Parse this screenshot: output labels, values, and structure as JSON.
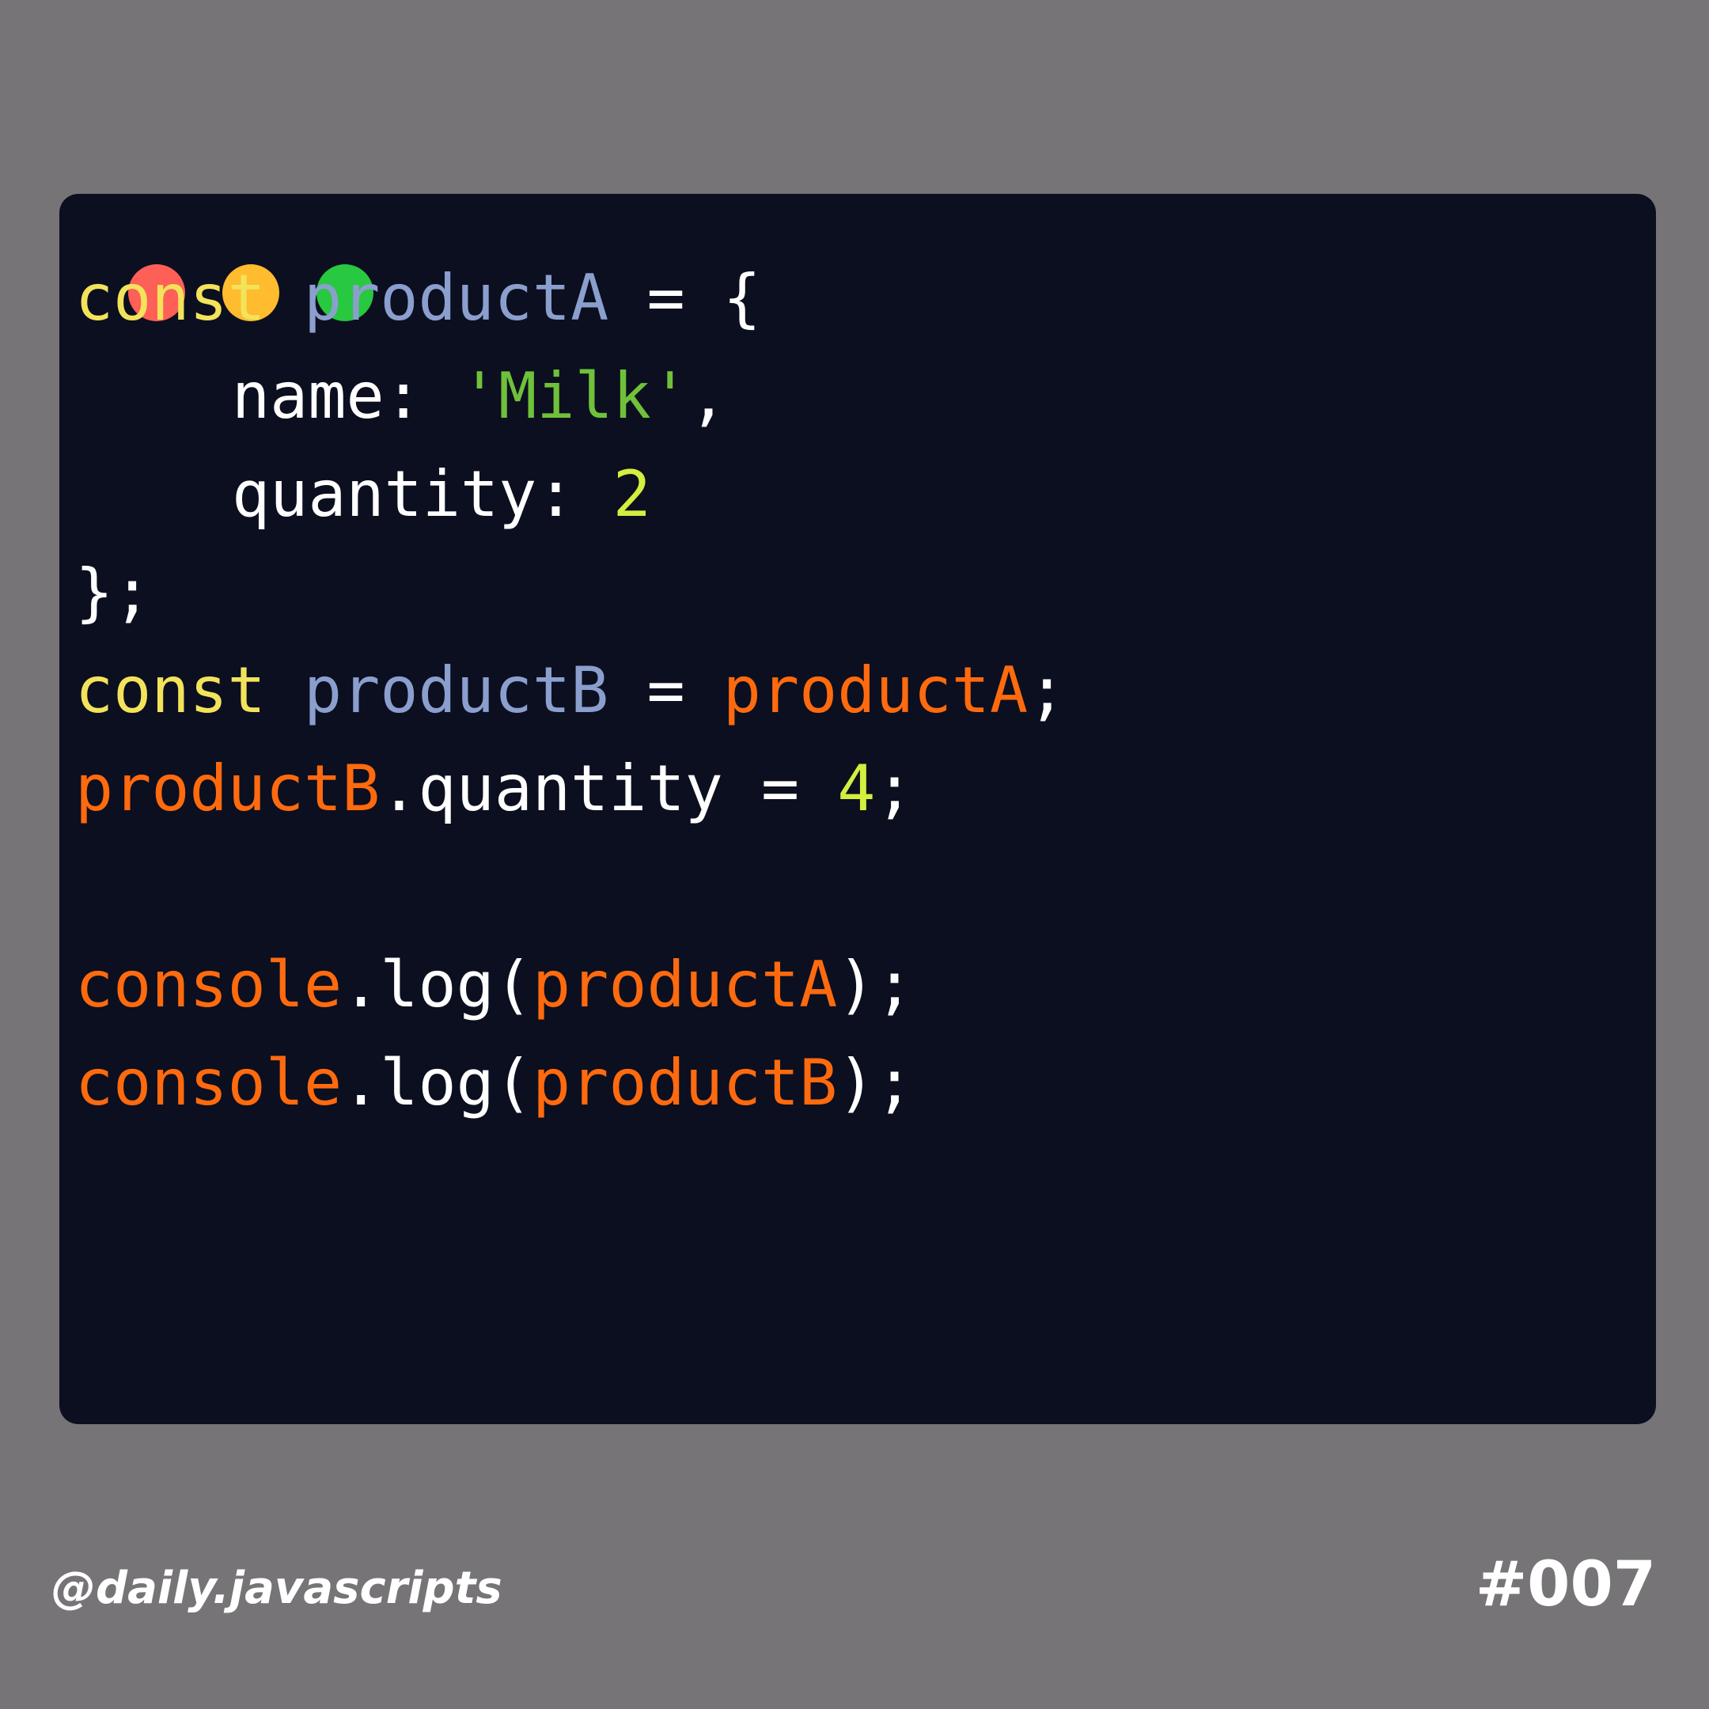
{
  "colors": {
    "background": "#767477",
    "card": "#0c0f1f",
    "keyword": "#f2e35b",
    "declaration": "#8b9fce",
    "identifier": "#ff6a0f",
    "string": "#6fc13a",
    "number": "#d3ee3f",
    "plain": "#ffffff"
  },
  "window_controls": [
    "close-dot",
    "minimize-dot",
    "maximize-dot"
  ],
  "code_lines": [
    [
      {
        "text": "const ",
        "color": "#f2e35b"
      },
      {
        "text": "productA",
        "color": "#8b9fce"
      },
      {
        "text": " = {",
        "color": "#ffffff"
      }
    ],
    [
      {
        "text": "name: ",
        "color": "#ffffff"
      },
      {
        "text": "'Milk'",
        "color": "#6fc13a"
      },
      {
        "text": ",",
        "color": "#ffffff"
      }
    ],
    [
      {
        "text": "quantity: ",
        "color": "#ffffff"
      },
      {
        "text": "2",
        "color": "#d3ee3f"
      }
    ],
    [
      {
        "text": "};",
        "color": "#ffffff"
      }
    ],
    [
      {
        "text": "const ",
        "color": "#f2e35b"
      },
      {
        "text": "productB",
        "color": "#8b9fce"
      },
      {
        "text": " = ",
        "color": "#ffffff"
      },
      {
        "text": "productA",
        "color": "#ff6a0f"
      },
      {
        "text": ";",
        "color": "#ffffff"
      }
    ],
    [
      {
        "text": "productB",
        "color": "#ff6a0f"
      },
      {
        "text": ".quantity = ",
        "color": "#ffffff"
      },
      {
        "text": "4",
        "color": "#d3ee3f"
      },
      {
        "text": ";",
        "color": "#ffffff"
      }
    ],
    [],
    [
      {
        "text": "console",
        "color": "#ff6a0f"
      },
      {
        "text": ".log(",
        "color": "#ffffff"
      },
      {
        "text": "productA",
        "color": "#ff6a0f"
      },
      {
        "text": ");",
        "color": "#ffffff"
      }
    ],
    [
      {
        "text": "console",
        "color": "#ff6a0f"
      },
      {
        "text": ".log(",
        "color": "#ffffff"
      },
      {
        "text": "productB",
        "color": "#ff6a0f"
      },
      {
        "text": ");",
        "color": "#ffffff"
      }
    ]
  ],
  "indented_lines": [
    1,
    2
  ],
  "footer": {
    "handle": "@daily.javascripts",
    "number": "#007"
  }
}
